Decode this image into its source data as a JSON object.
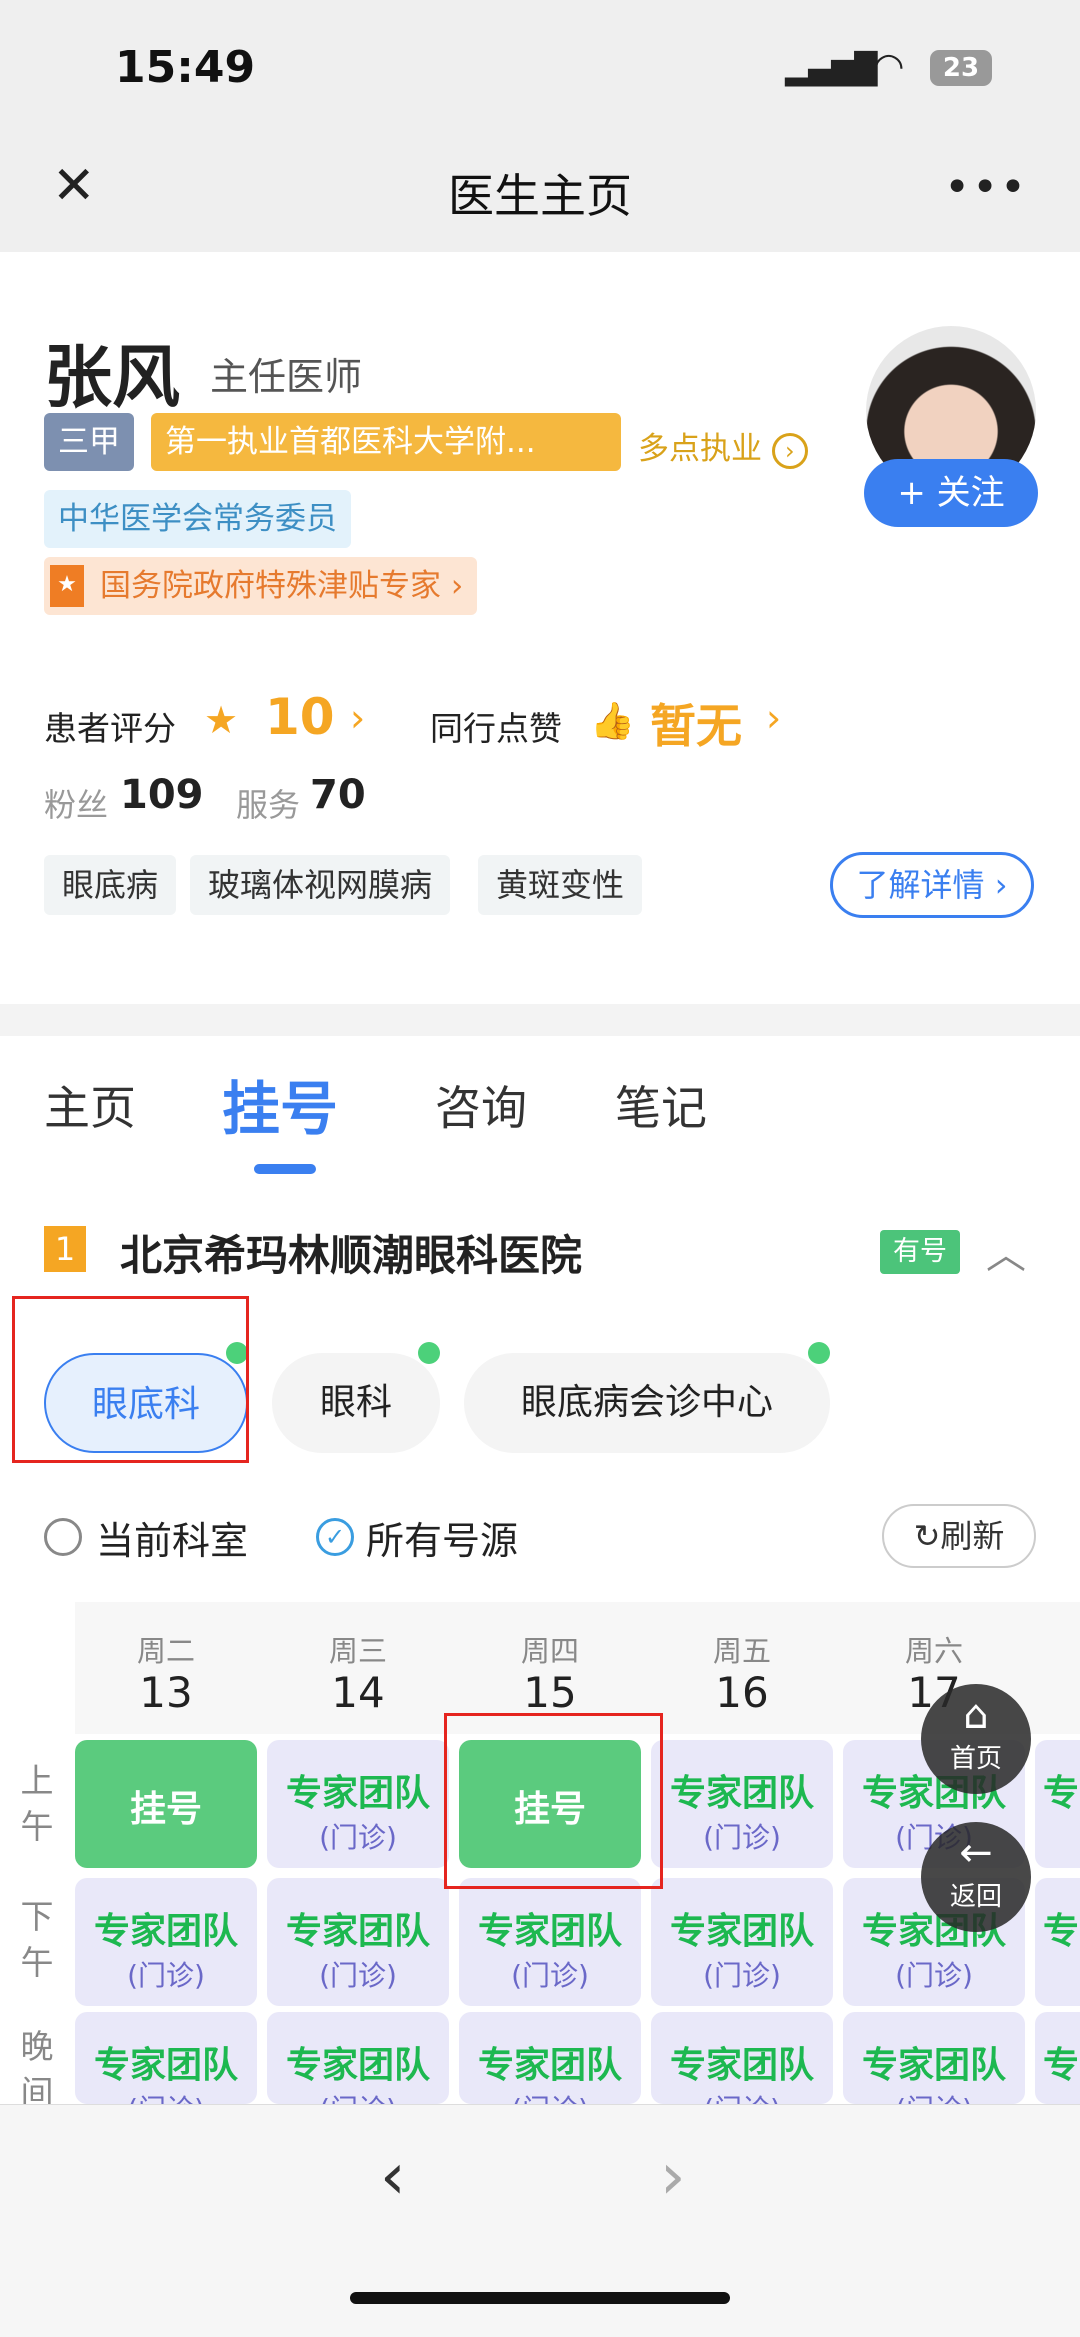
{
  "status": {
    "time": "15:49",
    "battery": "23"
  },
  "nav": {
    "title": "医生主页",
    "close": "✕",
    "more": "•••"
  },
  "doctor": {
    "name": "张风",
    "title": "主任医师",
    "hospital_level": "三甲",
    "first_practice": "第一执业首都医科大学附...",
    "multi_practice": "多点执业",
    "society": "中华医学会常务委员",
    "honor": "国务院政府特殊津贴专家",
    "follow": "+ 关注",
    "rating_label": "患者评分",
    "rating": "10",
    "peer_label": "同行点赞",
    "peer": "暂无",
    "fans_label": "粉丝",
    "fans": "109",
    "service_label": "服务",
    "service": "70",
    "specialties": [
      "眼底病",
      "玻璃体视网膜病",
      "黄斑变性"
    ],
    "details": "了解详情"
  },
  "tabs": [
    "主页",
    "挂号",
    "咨询",
    "笔记"
  ],
  "active_tab": "挂号",
  "hospital": {
    "index": "1",
    "name": "北京希玛林顺潮眼科医院",
    "badge": "有号"
  },
  "departments": [
    "眼底科",
    "眼科",
    "眼底病会诊中心"
  ],
  "filters": {
    "current": "当前科室",
    "all": "所有号源",
    "refresh": "刷新"
  },
  "schedule": {
    "rows": [
      "上午",
      "下午",
      "晚间"
    ],
    "days": [
      {
        "weekday": "周二",
        "date": "13",
        "slots": [
          {
            "a": "挂号"
          },
          {
            "a": "专家团队",
            "b": "(门诊)"
          },
          {
            "a": "专家团队",
            "b": "(门诊)"
          }
        ]
      },
      {
        "weekday": "周三",
        "date": "14",
        "slots": [
          {
            "a": "专家团队",
            "b": "(门诊)"
          },
          {
            "a": "专家团队",
            "b": "(门诊)"
          },
          {
            "a": "专家团队",
            "b": "(门诊)"
          }
        ]
      },
      {
        "weekday": "周四",
        "date": "15",
        "slots": [
          {
            "a": "挂号"
          },
          {
            "a": "专家团队",
            "b": "(门诊)"
          },
          {
            "a": "专家团队",
            "b": "(门诊)"
          }
        ]
      },
      {
        "weekday": "周五",
        "date": "16",
        "slots": [
          {
            "a": "专家团队",
            "b": "(门诊)"
          },
          {
            "a": "专家团队",
            "b": "(门诊)"
          },
          {
            "a": "专家团队",
            "b": "(门诊)"
          }
        ]
      },
      {
        "weekday": "周六",
        "date": "17",
        "slots": [
          {
            "a": "专家团队",
            "b": "(门诊)"
          },
          {
            "a": "专家团队",
            "b": "(门诊)"
          },
          {
            "a": "专家团队",
            "b": "(门诊)"
          }
        ]
      },
      {
        "weekday": "",
        "date": "",
        "slots": [
          {
            "a": "专"
          },
          {
            "a": "专"
          },
          {
            "a": "专"
          }
        ]
      }
    ]
  },
  "fab": {
    "home": "首页",
    "back": "返回"
  },
  "colors": {
    "accent": "#3a7ff0",
    "green": "#5bcb7e",
    "orange": "#f5b83f"
  }
}
